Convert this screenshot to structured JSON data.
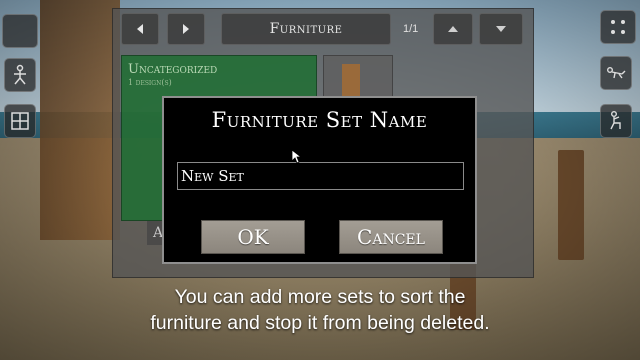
{
  "panel": {
    "title": "Furniture",
    "page_count": "1/1",
    "category": {
      "name": "Uncategorized",
      "count": "1 design(s)"
    },
    "add_label": "A"
  },
  "dialog": {
    "title": "Furniture Set Name",
    "input_value": "New Set",
    "ok_label": "OK",
    "cancel_label": "Cancel"
  },
  "caption": {
    "line1": "You can add more sets to sort the",
    "line2": "furniture and stop it from being deleted."
  },
  "icons": {
    "left_top": "stick-figure-icon",
    "left_bottom": "grid-icon",
    "right_1": "menu-icon",
    "right_2": "lying-figure-icon",
    "right_3": "sitting-figure-icon",
    "prev": "arrow-left-icon",
    "next": "arrow-right-icon",
    "up": "arrow-up-icon",
    "down": "arrow-down-icon"
  },
  "colors": {
    "dialog_bg": "#000000",
    "button": "#9a948b",
    "category_green": "#1e6e32"
  }
}
